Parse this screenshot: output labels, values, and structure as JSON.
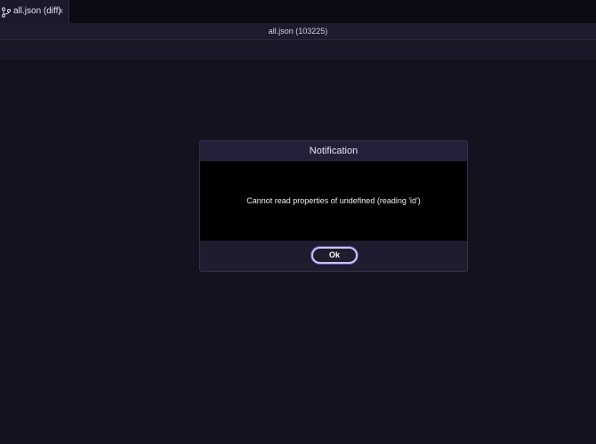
{
  "tab": {
    "label": "all.json (diff)",
    "close_glyph": "×",
    "icon": "git-compare-icon"
  },
  "header": {
    "title": "all.json (103225)"
  },
  "dialog": {
    "title": "Notification",
    "message": "Cannot read properties of undefined (reading 'id')",
    "ok_label": "Ok"
  },
  "colors": {
    "background": "#14121f",
    "dialog_body": "#000000",
    "button_focus_ring": "#5b52a8"
  }
}
